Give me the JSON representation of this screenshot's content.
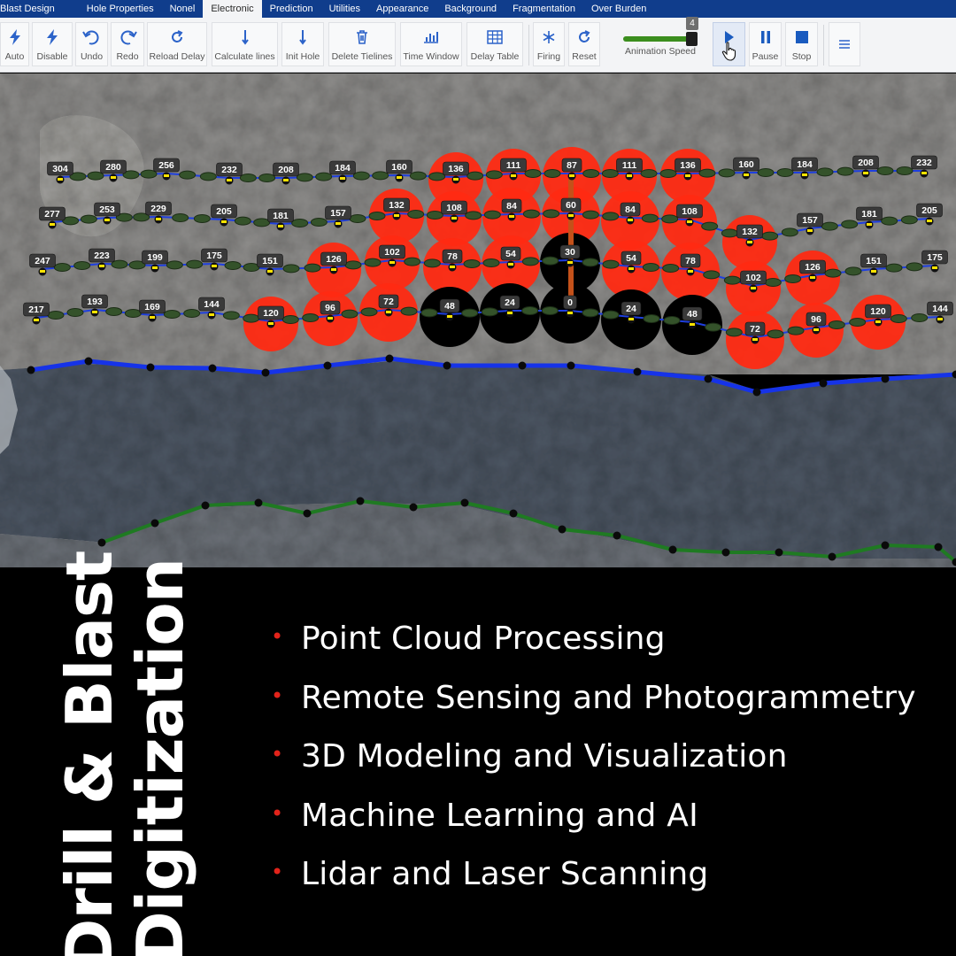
{
  "tabs": [
    "Blast Design",
    "Hole Properties",
    "Nonel",
    "Electronic",
    "Prediction",
    "Utilities",
    "Appearance",
    "Background",
    "Fragmentation",
    "Over Burden"
  ],
  "active_tab": "Electronic",
  "toolbar": {
    "auto": "Auto",
    "disable": "Disable",
    "undo": "Undo",
    "redo": "Redo",
    "reload_delay": "Reload Delay",
    "calculate_lines": "Calculate lines",
    "init_hole": "Init Hole",
    "delete_tielines": "Delete Tielines",
    "time_window": "Time Window",
    "delay_table": "Delay Table",
    "firing": "Firing",
    "reset": "Reset",
    "animation_speed_label": "Animation Speed",
    "animation_speed_value": "4",
    "animation_speed_max": 4,
    "pause": "Pause",
    "stop": "Stop"
  },
  "icons": {
    "auto": "lightning-icon",
    "disable": "lightning-icon",
    "undo": "undo-arrow-icon",
    "redo": "redo-arrow-icon",
    "reload_delay": "reload-icon",
    "calculate_lines": "down-arrow-icon",
    "init_hole": "down-arrow-icon",
    "delete_tielines": "trash-icon",
    "time_window": "bar-chart-icon",
    "delay_table": "table-icon",
    "firing": "snowflake-icon",
    "reset": "reload-icon",
    "play": "play-icon",
    "pause": "pause-icon",
    "stop": "stop-icon",
    "menu": "hamburger-menu-icon"
  },
  "colors": {
    "accent": "#1a5bbf",
    "tab_bar": "#103d8c",
    "fired_hole": "#ff2a12",
    "firing_hole": "#000000",
    "tieline": "#1e3fe0",
    "crest_line": "#1633e8",
    "toe_line": "#1f7a22",
    "bullet": "#e2231a"
  },
  "blast_rows": [
    {
      "row": 1,
      "delays": [
        304,
        280,
        256,
        232,
        208,
        184,
        160,
        136,
        111,
        87,
        111,
        136,
        160,
        184,
        208,
        232
      ]
    },
    {
      "row": 2,
      "delays": [
        277,
        253,
        229,
        205,
        181,
        157,
        132,
        108,
        84,
        60,
        84,
        108,
        132,
        157,
        181,
        205
      ]
    },
    {
      "row": 3,
      "delays": [
        247,
        223,
        199,
        175,
        151,
        126,
        102,
        78,
        54,
        30,
        54,
        78,
        102,
        126,
        151,
        175
      ]
    },
    {
      "row": 4,
      "delays": [
        217,
        193,
        169,
        144,
        120,
        96,
        72,
        48,
        24,
        0,
        24,
        48,
        72,
        96,
        120,
        144
      ]
    }
  ],
  "promo": {
    "title_line1": "Drill & Blast",
    "title_line2": "Digitization",
    "features": [
      "Point Cloud Processing",
      "Remote Sensing and Photogrammetry",
      "3D Modeling and Visualization",
      "Machine Learning and AI",
      "Lidar and Laser Scanning"
    ]
  }
}
